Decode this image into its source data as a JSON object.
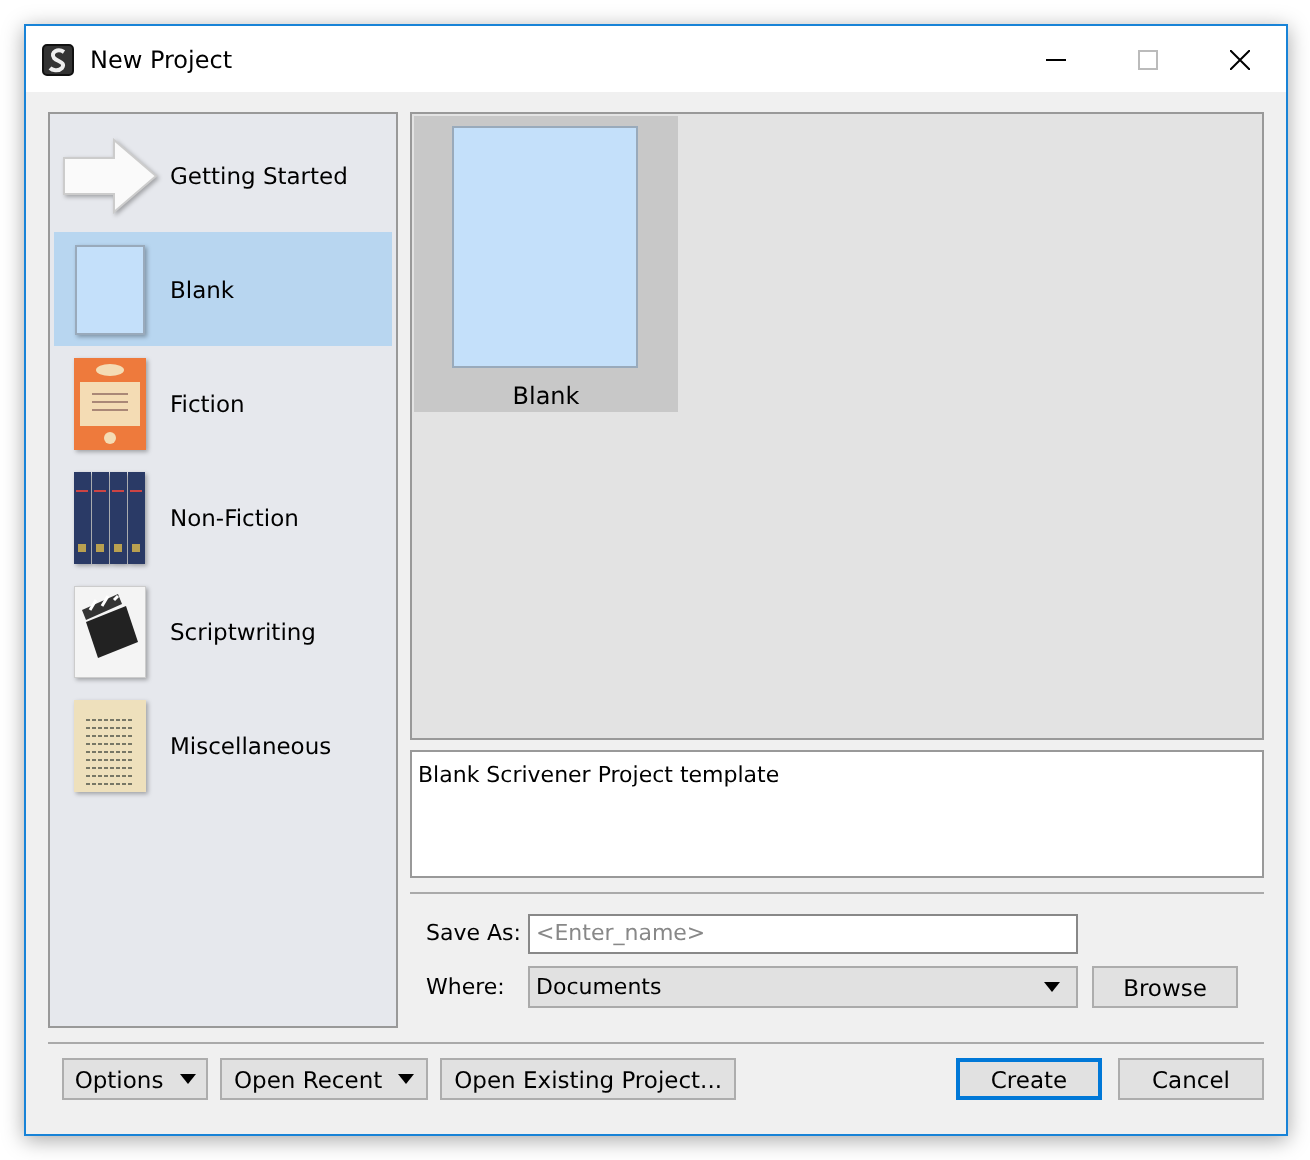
{
  "window": {
    "title": "New Project"
  },
  "categories": [
    {
      "label": "Getting Started",
      "kind": "arrow",
      "selected": false
    },
    {
      "label": "Blank",
      "kind": "blank",
      "selected": true
    },
    {
      "label": "Fiction",
      "kind": "fiction",
      "selected": false
    },
    {
      "label": "Non-Fiction",
      "kind": "nonfiction",
      "selected": false
    },
    {
      "label": "Scriptwriting",
      "kind": "script",
      "selected": false
    },
    {
      "label": "Miscellaneous",
      "kind": "misc",
      "selected": false
    }
  ],
  "templates": [
    {
      "label": "Blank",
      "selected": true
    }
  ],
  "description": "Blank Scrivener Project template",
  "save_as": {
    "label": "Save As:",
    "placeholder": "<Enter_name>"
  },
  "where": {
    "label": "Where:",
    "value": "Documents",
    "button": "Browse"
  },
  "footer_left": [
    {
      "label": "Options",
      "dropdown": true
    },
    {
      "label": "Open Recent",
      "dropdown": true
    },
    {
      "label": "Open Existing Project...",
      "dropdown": false
    }
  ],
  "footer_right": [
    {
      "label": "Create",
      "default": true
    },
    {
      "label": "Cancel",
      "default": false
    }
  ]
}
